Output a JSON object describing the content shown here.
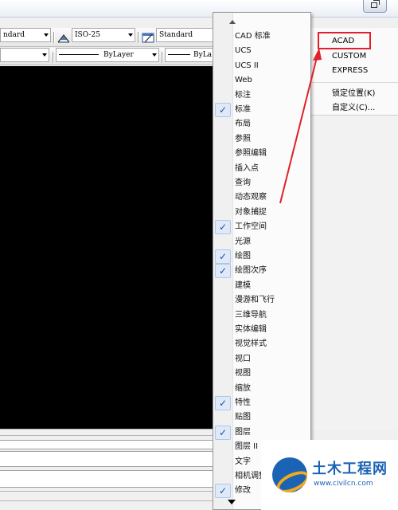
{
  "toolbar_style": {
    "text_style": "ndard",
    "dim_style": "ISO-25",
    "table_style": "Standard"
  },
  "toolbar_props": {
    "linetype": "ByLayer",
    "lineweight": "ByLa"
  },
  "menu": {
    "items": [
      {
        "label": "CAD 标准",
        "checked": false
      },
      {
        "label": "UCS",
        "checked": false
      },
      {
        "label": "UCS II",
        "checked": false
      },
      {
        "label": "Web",
        "checked": false
      },
      {
        "label": "标注",
        "checked": false
      },
      {
        "label": "标准",
        "checked": true
      },
      {
        "label": "布局",
        "checked": false
      },
      {
        "label": "参照",
        "checked": false
      },
      {
        "label": "参照编辑",
        "checked": false
      },
      {
        "label": "插入点",
        "checked": false
      },
      {
        "label": "查询",
        "checked": false
      },
      {
        "label": "动态观察",
        "checked": false
      },
      {
        "label": "对象捕捉",
        "checked": false
      },
      {
        "label": "工作空间",
        "checked": true
      },
      {
        "label": "光源",
        "checked": false
      },
      {
        "label": "绘图",
        "checked": true
      },
      {
        "label": "绘图次序",
        "checked": true
      },
      {
        "label": "建模",
        "checked": false
      },
      {
        "label": "漫游和飞行",
        "checked": false
      },
      {
        "label": "三维导航",
        "checked": false
      },
      {
        "label": "实体编辑",
        "checked": false
      },
      {
        "label": "视觉样式",
        "checked": false
      },
      {
        "label": "视口",
        "checked": false
      },
      {
        "label": "视图",
        "checked": false
      },
      {
        "label": "缩放",
        "checked": false
      },
      {
        "label": "特性",
        "checked": true
      },
      {
        "label": "贴图",
        "checked": false
      },
      {
        "label": "图层",
        "checked": true
      },
      {
        "label": "图层 II",
        "checked": false
      },
      {
        "label": "文字",
        "checked": false
      },
      {
        "label": "相机调整",
        "checked": false
      },
      {
        "label": "修改",
        "checked": true
      }
    ]
  },
  "right_panel": {
    "groups": [
      "ACAD",
      "CUSTOM",
      "EXPRESS"
    ],
    "lock_position": "锁定位置(K)",
    "customize": "自定义(C)..."
  },
  "watermark": {
    "title": "土木工程网",
    "url": "www.civilcn.com"
  },
  "colors": {
    "canvas": "#000000",
    "highlight": "#e1202b",
    "check": "#1f4fa8",
    "logo": "#1b63b5"
  }
}
